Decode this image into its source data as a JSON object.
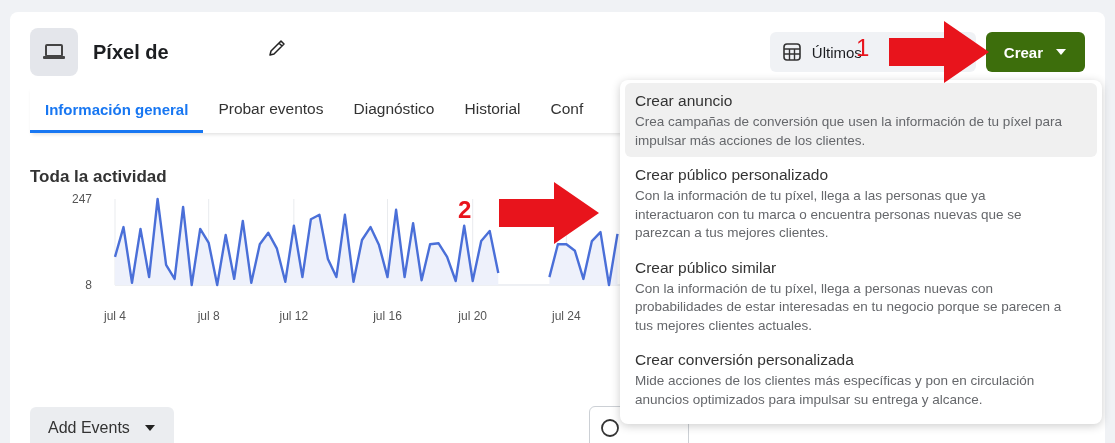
{
  "header": {
    "title": "Píxel de",
    "date_button": {
      "label": "Últimos"
    },
    "create_button": {
      "label": "Crear"
    }
  },
  "tabs": [
    {
      "label": "Información general",
      "selected": true
    },
    {
      "label": "Probar eventos",
      "selected": false
    },
    {
      "label": "Diagnóstico",
      "selected": false
    },
    {
      "label": "Historial",
      "selected": false
    },
    {
      "label": "Conf",
      "selected": false
    }
  ],
  "activity": {
    "title": "Toda la actividad",
    "chart_data": {
      "type": "line",
      "categories": [
        "jul 4",
        null,
        null,
        null,
        null,
        null,
        null,
        null,
        null,
        null,
        null,
        "jul 8",
        null,
        null,
        null,
        null,
        null,
        null,
        null,
        null,
        null,
        "jul 12",
        null,
        null,
        null,
        null,
        null,
        null,
        null,
        null,
        null,
        null,
        "jul 16",
        null,
        null,
        null,
        null,
        null,
        null,
        null,
        null,
        null,
        "jul 20",
        null,
        null,
        null,
        null,
        null,
        null,
        null,
        null,
        null,
        null,
        "jul 24",
        null,
        null,
        null,
        null,
        null,
        null,
        null
      ],
      "series": [
        {
          "color": "#4a6fd8",
          "values": [
            86,
            169,
            14,
            164,
            30,
            247,
            64,
            25,
            225,
            8,
            164,
            125,
            8,
            147,
            25,
            186,
            14,
            121,
            153,
            110,
            17,
            173,
            30,
            191,
            203,
            80,
            30,
            203,
            17,
            133,
            169,
            119,
            30,
            217,
            30,
            180,
            21,
            121,
            124,
            86,
            19,
            173,
            19,
            130,
            158,
            41,
            null,
            null,
            null,
            null,
            null,
            30,
            121,
            121,
            103,
            25,
            130,
            155,
            8,
            150,
            null
          ]
        }
      ],
      "grid": true,
      "ylim": [
        8,
        247
      ],
      "yticks": [
        8,
        247
      ]
    }
  },
  "add_events_button": {
    "label": "Add Events"
  },
  "create_menu": {
    "items": [
      {
        "title": "Crear anuncio",
        "description": "Crea campañas de conversión que usen la información de tu píxel para impulsar más acciones de los clientes.",
        "selected": true
      },
      {
        "title": "Crear público personalizado",
        "description": "Con la información de tu píxel, llega a las personas que ya interactuaron con tu marca o encuentra personas nuevas que se parezcan a tus mejores clientes.",
        "selected": false
      },
      {
        "title": "Crear público similar",
        "description": "Con la información de tu píxel, llega a personas nuevas con probabilidades de estar interesadas en tu negocio porque se parecen a tus mejores clientes actuales.",
        "selected": false
      },
      {
        "title": "Crear conversión personalizada",
        "description": "Mide acciones de los clientes más específicas y pon en circulación anuncios optimizados para impulsar su entrega y alcance.",
        "selected": false
      }
    ]
  },
  "annotations": [
    {
      "number": "1"
    },
    {
      "number": "2"
    }
  ]
}
